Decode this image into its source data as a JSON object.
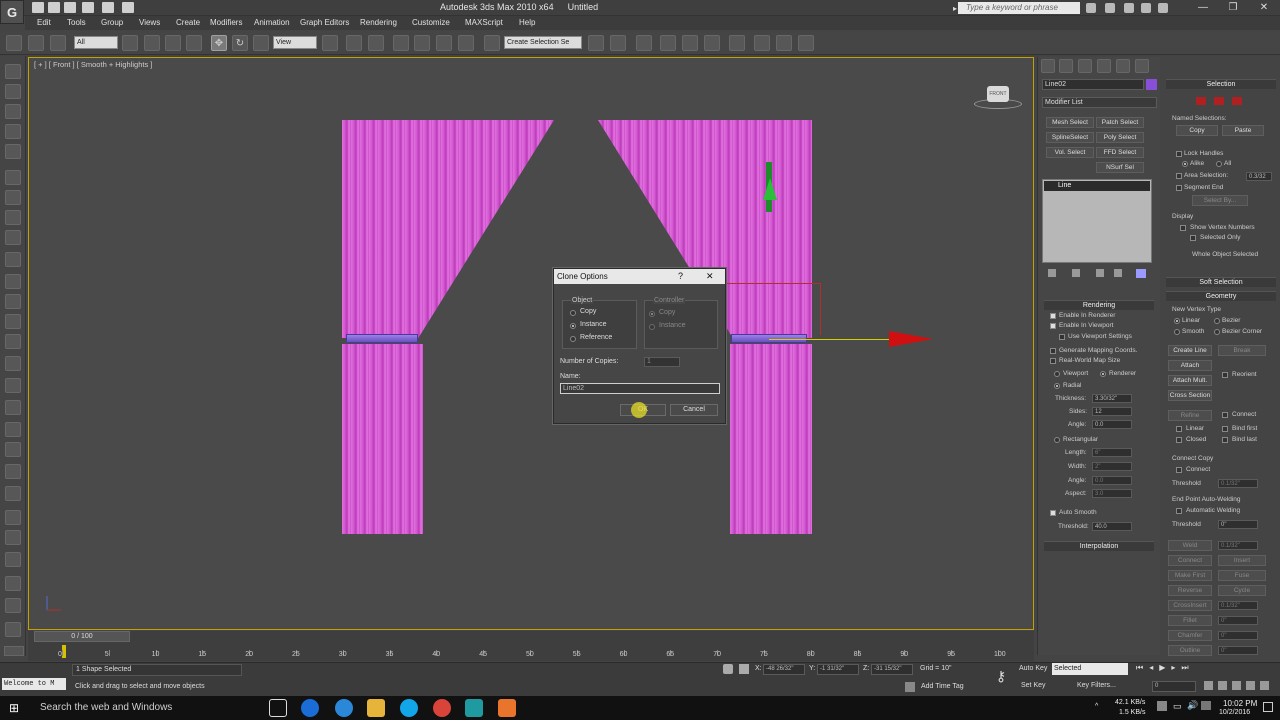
{
  "app": {
    "logo": "G",
    "title": "Autodesk 3ds Max  2010 x64",
    "document": "Untitled",
    "search_placeholder": "Type a keyword or phrase"
  },
  "menu": [
    "Edit",
    "Tools",
    "Group",
    "Views",
    "Create",
    "Modifiers",
    "Animation",
    "Graph Editors",
    "Rendering",
    "Customize",
    "MAXScript",
    "Help"
  ],
  "toolbar": {
    "selection_filter": "All",
    "ref_coord": "View",
    "named_selection": "Create Selection Se"
  },
  "viewport": {
    "label": "[ + ] [ Front ] [ Smooth + Highlights ]",
    "viewcube_label": "FRONT"
  },
  "dialog": {
    "title": "Clone Options",
    "help": "?",
    "close": "✕",
    "object_group": "Object",
    "object_options": [
      "Copy",
      "Instance",
      "Reference"
    ],
    "object_selected": "Instance",
    "controller_group": "Controller",
    "controller_options": [
      "Copy",
      "Instance"
    ],
    "controller_selected": "Copy",
    "copies_label": "Number of Copies:",
    "copies_value": "1",
    "name_label": "Name:",
    "name_value": "Line02",
    "ok_label": "OK",
    "cancel_label": "Cancel"
  },
  "command_panel": {
    "object_name": "Line02",
    "object_color": "#8a4fd8",
    "modifier_list": "Modifier List",
    "modifier_buttons": [
      "Mesh Select",
      "Patch Select",
      "SplineSelect",
      "Poly Select",
      "Vol. Select",
      "FFD Select",
      "NSurf Sel"
    ],
    "stack_items": [
      "Line"
    ],
    "rendering": {
      "header": "Rendering",
      "enable_in_renderer": "Enable In Renderer",
      "enable_in_viewport": "Enable In Viewport",
      "use_viewport_settings": "Use Viewport Settings",
      "generate_mapping": "Generate Mapping Coords.",
      "real_world_map": "Real-World Map Size",
      "viewport": "Viewport",
      "renderer": "Renderer",
      "radial": "Radial",
      "thickness_label": "Thickness:",
      "thickness_value": "3.30/32\"",
      "sides_label": "Sides:",
      "sides_value": "12",
      "angle_label": "Angle:",
      "angle_value": "0.0",
      "rectangular": "Rectangular",
      "length_label": "Length:",
      "length_value": "6\"",
      "width_label": "Width:",
      "width_value": "2\"",
      "angle2_label": "Angle:",
      "angle2_value": "0.0",
      "aspect_label": "Aspect:",
      "aspect_value": "3.0",
      "auto_smooth": "Auto Smooth",
      "threshold_label": "Threshold:",
      "threshold_value": "40.0"
    },
    "interpolation": "Interpolation"
  },
  "right_panel": {
    "selection_header": "Selection",
    "named_selections": "Named Selections:",
    "copy": "Copy",
    "paste": "Paste",
    "lock_handles": "Lock Handles",
    "alike": "Alike",
    "all": "All",
    "area_selection": "Area Selection:",
    "area_value": "0.3/32",
    "segment_end": "Segment End",
    "select_by": "Select By...",
    "display": "Display",
    "show_vertex_numbers": "Show Vertex Numbers",
    "selected_only": "Selected Only",
    "whole_object_selected": "Whole Object Selected",
    "soft_selection": "Soft Selection",
    "geometry": "Geometry",
    "new_vertex_type": "New Vertex Type",
    "vertex_types": [
      "Linear",
      "Bezier",
      "Smooth",
      "Bezier Corner"
    ],
    "create_line": "Create Line",
    "break": "Break",
    "attach": "Attach",
    "reorient": "Reorient",
    "attach_mult": "Attach Mult.",
    "cross_section": "Cross Section",
    "refine": "Refine",
    "connect": "Connect",
    "linear": "Linear",
    "bind_first": "Bind first",
    "closed": "Closed",
    "bind_last": "Bind last",
    "connect_copy": "Connect Copy",
    "connect2": "Connect",
    "threshold": "Threshold",
    "threshold_value": "0.1/32\"",
    "endpoint_welding": "End Point Auto-Welding",
    "automatic_welding": "Automatic Welding",
    "threshold2": "Threshold",
    "threshold2_value": "0\"",
    "weld": "Weld",
    "weld_value": "0.1/32\"",
    "connect3": "Connect",
    "insert": "Insert",
    "make_first": "Make First",
    "fuse": "Fuse",
    "reverse": "Reverse",
    "cycle": "Cycle",
    "crossinsert": "CrossInsert",
    "crossinsert_value": "0.1/32\"",
    "fillet": "Fillet",
    "fillet_value": "0\"",
    "chamfer": "Chamfer",
    "chamfer_value": "0\"",
    "outline": "Outline",
    "outline_value": "0\""
  },
  "timeline": {
    "slider_label": "0 / 100",
    "ticks": [
      "0",
      "5",
      "10",
      "15",
      "20",
      "25",
      "30",
      "35",
      "40",
      "45",
      "50",
      "55",
      "60",
      "65",
      "70",
      "75",
      "80",
      "85",
      "90",
      "95",
      "100"
    ]
  },
  "status": {
    "welcome": "Welcome to M",
    "selected_count": "1 Shape Selected",
    "prompt": "Click and drag to select and move objects",
    "x_label": "X:",
    "x_value": "-48 26/32\"",
    "y_label": "Y:",
    "y_value": "-1 31/32\"",
    "z_label": "Z:",
    "z_value": "-31 15/32\"",
    "grid": "Grid = 10\"",
    "add_time_tag": "Add Time Tag",
    "auto_key": "Auto Key",
    "set_key": "Set Key",
    "selected_dropdown": "Selected",
    "key_filters": "Key Filters...",
    "frame_value": "0"
  },
  "taskbar": {
    "search": "Search the web and Windows",
    "net_up": "42.1 KB/s",
    "net_down": "1.5 KB/s",
    "time": "10:02 PM",
    "date": "10/2/2016"
  }
}
